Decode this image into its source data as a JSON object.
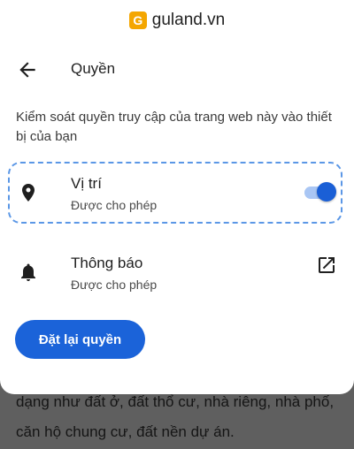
{
  "site": {
    "logo_letter": "G",
    "domain": "guland.vn"
  },
  "header": {
    "back_icon": "arrow-left-icon",
    "title": "Quyền"
  },
  "description": "Kiểm soát quyền truy cập của trang web này vào thiết bị của bạn",
  "permissions": [
    {
      "icon": "location-pin-icon",
      "title": "Vị trí",
      "status": "Được cho phép",
      "toggle_on": true
    },
    {
      "icon": "bell-icon",
      "title": "Thông báo",
      "status": "Được cho phép",
      "action_icon": "open-in-new-icon"
    }
  ],
  "reset_button_label": "Đặt lại quyền",
  "background_text": "dạng như đất ở, đất thổ cư, nhà riêng, nhà phố, căn hộ chung cư, đất nền dự án.",
  "colors": {
    "accent": "#1b63d9",
    "highlight_border": "#5b97e6",
    "toggle_track": "#a9c6f4",
    "logo": "#f4a600"
  }
}
